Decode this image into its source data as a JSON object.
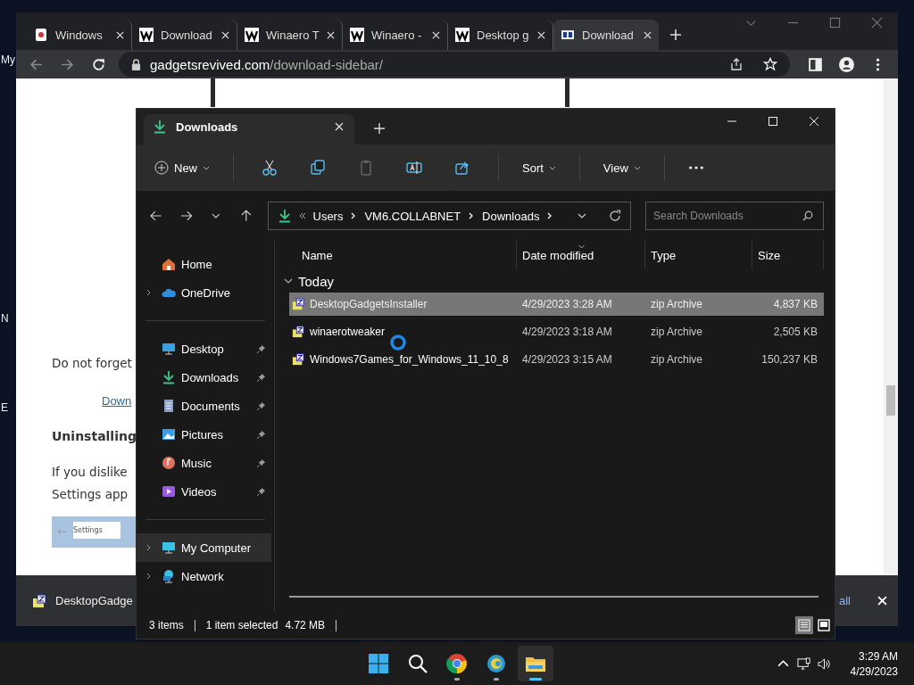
{
  "desktop_icons": [
    {
      "label": "My"
    },
    {
      "label": "N"
    },
    {
      "label": "E"
    }
  ],
  "browser": {
    "tabs": [
      {
        "label": "Windows",
        "selected": false
      },
      {
        "label": "Download",
        "selected": false
      },
      {
        "label": "Winaero T",
        "selected": false
      },
      {
        "label": "Winaero -",
        "selected": false
      },
      {
        "label": "Desktop g",
        "selected": false
      },
      {
        "label": "Download",
        "selected": true
      }
    ],
    "url": {
      "domain": "gadgetsrevived.com",
      "path": "/download-sidebar/"
    },
    "page": {
      "paragraph_1": "Do not forget",
      "link": "Down",
      "heading": "Uninstalling",
      "paragraph_2": [
        "If you dislike",
        "Settings app"
      ],
      "screenshot_title": "Settings"
    },
    "download_bar": {
      "file": "DesktopGadge",
      "show_all": "all"
    }
  },
  "explorer": {
    "tab": "Downloads",
    "commands": [
      {
        "kind": "menu",
        "label": "New"
      },
      {
        "kind": "icon",
        "disabled": false
      },
      {
        "kind": "icon",
        "disabled": false
      },
      {
        "kind": "icon",
        "disabled": true
      },
      {
        "kind": "icon",
        "disabled": false
      },
      {
        "kind": "icon",
        "disabled": false
      },
      {
        "kind": "menu",
        "label": "Sort"
      },
      {
        "kind": "menu",
        "label": "View"
      },
      {
        "kind": "more"
      }
    ],
    "breadcrumb": [
      "Users",
      "VM6.COLLABNET",
      "Downloads"
    ],
    "search": {
      "placeholder": "Search Downloads"
    },
    "nav": [
      {
        "label": "Home",
        "kind": "plain",
        "selected": false
      },
      {
        "label": "OneDrive",
        "kind": "expandable",
        "selected": false
      },
      {
        "kind": "divider"
      },
      {
        "label": "Desktop",
        "kind": "pinned",
        "selected": false
      },
      {
        "label": "Downloads",
        "kind": "pinned",
        "selected": false
      },
      {
        "label": "Documents",
        "kind": "pinned",
        "selected": false
      },
      {
        "label": "Pictures",
        "kind": "pinned",
        "selected": false
      },
      {
        "label": "Music",
        "kind": "pinned",
        "selected": false
      },
      {
        "label": "Videos",
        "kind": "pinned",
        "selected": false
      },
      {
        "kind": "divider"
      },
      {
        "label": "My Computer",
        "kind": "expandable",
        "selected": true
      },
      {
        "label": "Network",
        "kind": "expandable",
        "selected": false
      }
    ],
    "columns": [
      "Name",
      "Date modified",
      "Type",
      "Size"
    ],
    "group": {
      "label": "Today",
      "expanded": true
    },
    "files": [
      {
        "name": "DesktopGadgetsInstaller",
        "date": "4/29/2023 3:28 AM",
        "type": "zip Archive",
        "size": "4,837 KB",
        "selected": true
      },
      {
        "name": "winaerotweaker",
        "date": "4/29/2023 3:18 AM",
        "type": "zip Archive",
        "size": "2,505 KB",
        "selected": false
      },
      {
        "name": "Windows7Games_for_Windows_11_10_8",
        "date": "4/29/2023 3:15 AM",
        "type": "zip Archive",
        "size": "150,237 KB",
        "selected": false
      }
    ],
    "status": {
      "count": "3 items",
      "selection": "1 item selected",
      "size": "4.72 MB"
    },
    "views": [
      {
        "selected": true
      },
      {
        "selected": false
      }
    ]
  },
  "taskbar": {
    "apps": [
      {
        "selected": false,
        "running": false
      },
      {
        "selected": false,
        "running": false
      },
      {
        "selected": false,
        "running": true
      },
      {
        "selected": false,
        "running": true
      },
      {
        "selected": true,
        "running": true
      }
    ],
    "time": "3:29 AM",
    "date": "4/29/2023"
  }
}
